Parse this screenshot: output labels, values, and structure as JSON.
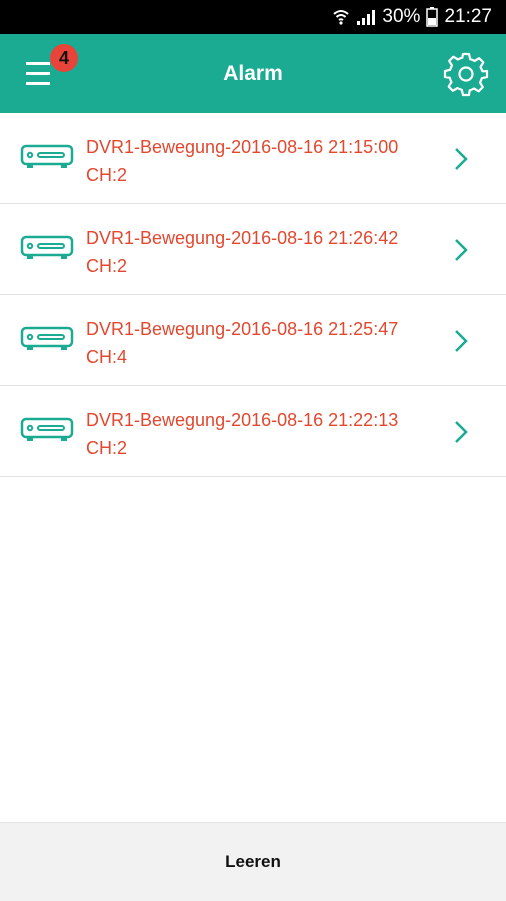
{
  "status_bar": {
    "battery": "30%",
    "time": "21:27",
    "icons": [
      "wifi-icon",
      "signal-icon",
      "battery-icon"
    ]
  },
  "app_bar": {
    "title": "Alarm",
    "badge_count": "4",
    "menu_icon": "hamburger-menu-icon",
    "settings_icon": "gear-icon",
    "background": "#1bab92"
  },
  "alarms": [
    {
      "title": "DVR1-Bewegung-2016-08-16 21:15:00",
      "channel": "CH:2"
    },
    {
      "title": "DVR1-Bewegung-2016-08-16 21:26:42",
      "channel": "CH:2"
    },
    {
      "title": "DVR1-Bewegung-2016-08-16 21:25:47",
      "channel": "CH:4"
    },
    {
      "title": "DVR1-Bewegung-2016-08-16 21:22:13",
      "channel": "CH:2"
    }
  ],
  "alarm_text_color": "#e1482f",
  "accent_color": "#1bab92",
  "bottom_bar": {
    "clear_label": "Leeren"
  }
}
